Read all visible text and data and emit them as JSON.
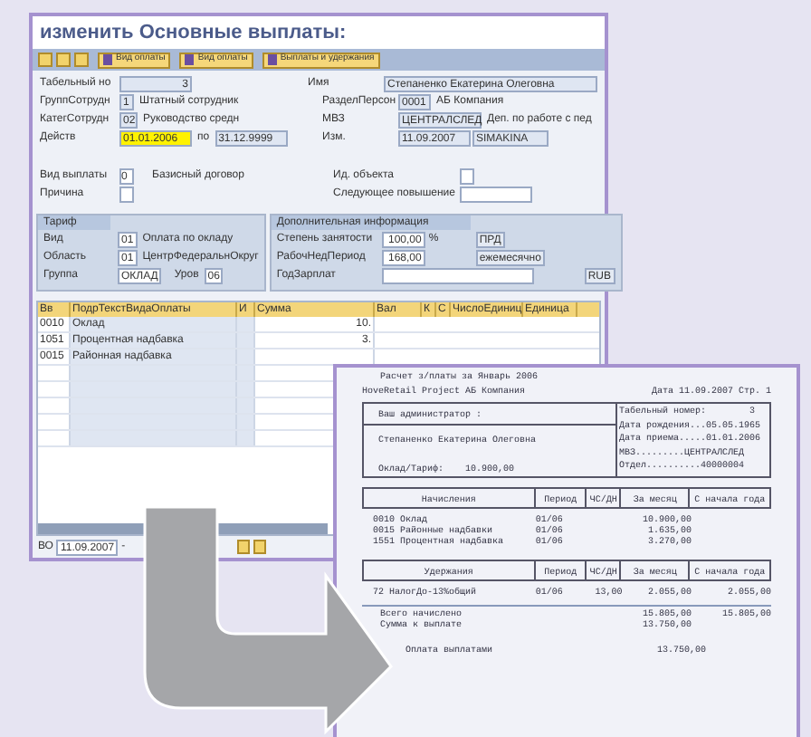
{
  "window": {
    "title": "изменить Основные выплаты:"
  },
  "toolbar": [
    {
      "kind": "icon"
    },
    {
      "kind": "icon"
    },
    {
      "kind": "icon"
    },
    {
      "kind": "button",
      "label": "Вид оплаты"
    },
    {
      "kind": "button",
      "label": "Вид оплаты"
    },
    {
      "kind": "button",
      "label": "Выплаты и удержания"
    }
  ],
  "header_rows": [
    {
      "label": "Табельный но",
      "fields": [
        {
          "value": "3"
        }
      ],
      "label2": "Имя",
      "fields2": [
        {
          "value": "Степаненко Екатерина Олеговна"
        }
      ]
    },
    {
      "label": "ГруппСотрудн",
      "fields": [
        {
          "value": "1"
        },
        {
          "text": "Штатный сотрудник"
        }
      ],
      "label2": "РазделПерсон",
      "fields2": [
        {
          "value": "0001"
        },
        {
          "text": "АБ Компания"
        }
      ]
    },
    {
      "label": "КатегСотрудн",
      "fields": [
        {
          "value": "02"
        },
        {
          "text": "Руководство средн"
        }
      ],
      "label2": "МВЗ",
      "fields2": [
        {
          "value": "ЦЕНТРАЛСЛЕД"
        },
        {
          "text": "Деп. по работе с пед"
        }
      ]
    },
    {
      "label": "Действ",
      "fields": [
        {
          "value": "01.01.2006",
          "focused": true
        },
        {
          "text": "по"
        },
        {
          "value": "31.12.9999",
          "focused": false
        }
      ],
      "label2": "Изм.",
      "fields2": [
        {
          "value": "11.09.2007"
        },
        {
          "value": "SIMAKINA"
        }
      ]
    }
  ],
  "payment": [
    {
      "label": "Вид выплаты",
      "value": "0",
      "text": "Базисный договор",
      "label2": "Ид. объекта"
    },
    {
      "label": "Причина",
      "label2": "Следующее повышение"
    }
  ],
  "tariff": {
    "title": "Тариф",
    "rows": [
      {
        "label": "Вид",
        "value": "01",
        "text": "Оплата по окладу"
      },
      {
        "label": "Область",
        "value": "01",
        "text": "ЦентрФедеральнОкруг"
      },
      {
        "label": "Группа",
        "value": "ОКЛАД",
        "label2": "Уров",
        "value2": "06"
      }
    ]
  },
  "extra": {
    "title": "Дополнительная информация",
    "rows": [
      {
        "label": "Степень занятости",
        "value": "100,00",
        "unit": "%",
        "box": "ПРД"
      },
      {
        "label": "РабочНедПериод",
        "value": "168,00",
        "box": "ежемесячно"
      },
      {
        "label": "ГодЗарплат",
        "box": "RUB"
      }
    ]
  },
  "table": {
    "columns": [
      "Вв",
      "ПодрТекстВидаОплаты",
      "И",
      "Сумма",
      "Вал",
      "К",
      "С",
      "ЧислоЕдиниц",
      "Единица"
    ],
    "rows": [
      [
        "0010",
        "Оклад",
        "",
        "10."
      ],
      [
        "1051",
        "Процентная надбавка",
        "",
        "3."
      ],
      [
        "0015",
        "Районная надбавка",
        "",
        ""
      ]
    ]
  },
  "status": {
    "label": "ВО",
    "date": "11.09.2007",
    "sep": "-"
  },
  "payslip": {
    "title": "Расчет з/платы за  Январь 2006",
    "company": "HoveRetail Project АБ Компания",
    "date": "Дата  11.09.2007  Стр.   1",
    "admin": "Ваш администратор :",
    "employee": "Степаненко Екатерина Олеговна",
    "salary": "Оклад/Тариф:    10.900,00",
    "info": [
      "Табельный номер:        3",
      "Дата рождения...05.05.1965",
      "Дата приема.....01.01.2006",
      "МВЗ.........ЦЕНТРАЛСЛЕД",
      "Отдел..........40000004"
    ],
    "sections": [
      {
        "columns": [
          "Начисления",
          "Период",
          "ЧС/ДН",
          "За месяц",
          "С начала года"
        ],
        "rows": [
          [
            "0010 Оклад",
            "01/06",
            "",
            "10.900,00",
            ""
          ],
          [
            "0015 Районные надбавки",
            "01/06",
            "",
            "1.635,00",
            ""
          ],
          [
            "1551 Процентная надбавка",
            "01/06",
            "",
            "3.270,00",
            ""
          ]
        ]
      },
      {
        "columns": [
          "Удержания",
          "Период",
          "ЧС/ДН",
          "За месяц",
          "С начала года"
        ],
        "rows": [
          [
            "72 НалогДо-13%общий",
            "01/06",
            "13,00",
            "2.055,00",
            "2.055,00"
          ]
        ]
      }
    ],
    "totals": [
      {
        "label": "Всего начислено",
        "month": "15.805,00",
        "year": "15.805,00"
      },
      {
        "label": "Сумма к выплате",
        "month": "13.750,00"
      }
    ],
    "paid": [
      "Оплата выплатами",
      "13.750,00"
    ]
  }
}
